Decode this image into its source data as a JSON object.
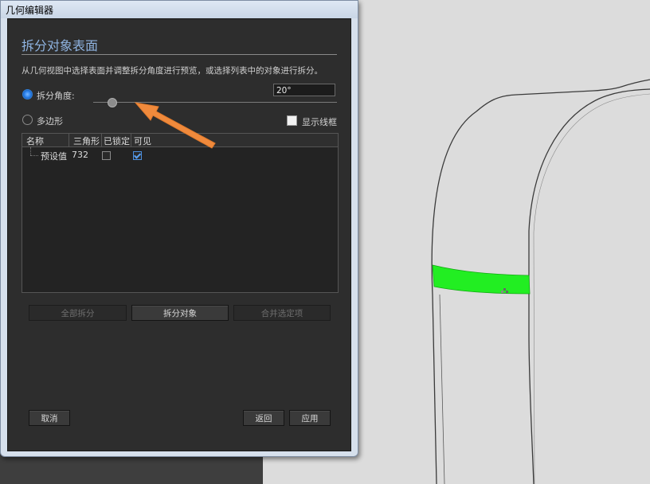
{
  "window": {
    "title": "几何编辑器"
  },
  "dialog": {
    "heading": "拆分对象表面",
    "description": "从几何视图中选择表面并调整拆分角度进行预览，或选择列表中的对象进行拆分。",
    "split_angle_label": "拆分角度:",
    "polygon_label": "多边形",
    "angle_value": "20°",
    "show_wireframe_label": "显示线框",
    "selected_mode": "split_angle",
    "slider_level_deg": 20
  },
  "table": {
    "columns": [
      "名称",
      "三角形",
      "已锁定",
      "可见"
    ],
    "rows": [
      {
        "name": "预设值",
        "triangles": "732",
        "locked": false,
        "visible": true
      }
    ]
  },
  "buttons": {
    "split_all": "全部拆分",
    "split_object": "拆分对象",
    "merge_selected": "合并选定项",
    "cancel": "取消",
    "back": "返回",
    "apply": "应用"
  },
  "colors": {
    "accent": "#2f86f0",
    "heading": "#8fb3e0",
    "annotation_arrow": "#f08a3c",
    "selection_highlight": "#22ee22",
    "panel": "#2d2d2d"
  },
  "icons": {
    "annotation": "arrow-icon",
    "cursor": "cursor-icon"
  }
}
